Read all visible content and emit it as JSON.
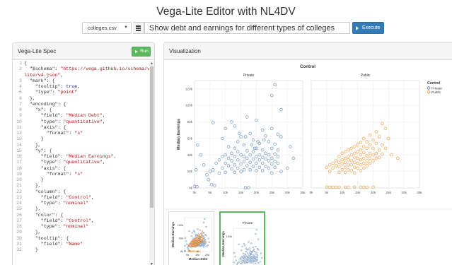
{
  "app": {
    "title": "Vega-Lite Editor with NL4DV"
  },
  "query": {
    "dataset": "colleges.csv",
    "text": "Show debt and earnings for different types of colleges",
    "execute_label": "Execute"
  },
  "spec_panel": {
    "title": "Vega-Lite Spec",
    "run_label": "Run",
    "lines": [
      {
        "n": "1",
        "t": "{"
      },
      {
        "n": "2",
        "t": "  \"$schema\": \"https://vega.github.io/schema/vega-"
      },
      {
        "n": "",
        "t": "lite/v4.json\","
      },
      {
        "n": "3",
        "t": "  \"mark\": {"
      },
      {
        "n": "4",
        "t": "    \"tooltip\": true,"
      },
      {
        "n": "5",
        "t": "    \"type\": \"point\""
      },
      {
        "n": "6",
        "t": "  },"
      },
      {
        "n": "7",
        "t": "  \"encoding\": {"
      },
      {
        "n": "8",
        "t": "    \"x\": {"
      },
      {
        "n": "9",
        "t": "      \"field\": \"Median Debt\","
      },
      {
        "n": "10",
        "t": "      \"type\": \"quantitative\","
      },
      {
        "n": "11",
        "t": "      \"axis\": {"
      },
      {
        "n": "12",
        "t": "        \"format\": \"s\""
      },
      {
        "n": "13",
        "t": "      }"
      },
      {
        "n": "14",
        "t": "    },"
      },
      {
        "n": "15",
        "t": "    \"y\": {"
      },
      {
        "n": "16",
        "t": "      \"field\": \"Median Earnings\","
      },
      {
        "n": "17",
        "t": "      \"type\": \"quantitative\","
      },
      {
        "n": "18",
        "t": "      \"axis\": {"
      },
      {
        "n": "19",
        "t": "        \"format\": \"s\""
      },
      {
        "n": "20",
        "t": "      }"
      },
      {
        "n": "21",
        "t": "    },"
      },
      {
        "n": "22",
        "t": "    \"column\": {"
      },
      {
        "n": "23",
        "t": "      \"field\": \"Control\","
      },
      {
        "n": "24",
        "t": "      \"type\": \"nominal\""
      },
      {
        "n": "25",
        "t": "    },"
      },
      {
        "n": "26",
        "t": "    \"color\": {"
      },
      {
        "n": "27",
        "t": "      \"field\": \"Control\","
      },
      {
        "n": "28",
        "t": "      \"type\": \"nominal\""
      },
      {
        "n": "29",
        "t": "    },"
      },
      {
        "n": "30",
        "t": "    \"tooltip\": {"
      },
      {
        "n": "31",
        "t": "      \"field\": \"Name\""
      },
      {
        "n": "32",
        "t": "    }"
      }
    ]
  },
  "viz_panel": {
    "title": "Visualization"
  },
  "chart_data": {
    "type": "scatter",
    "column_title": "Control",
    "facets": [
      "Private",
      "Public"
    ],
    "xlabel": "Median Debt",
    "ylabel": "Median Earnings",
    "x_ticks": [
      "0k",
      "5k",
      "10k",
      "15k",
      "20k",
      "25k",
      "30k",
      "35k"
    ],
    "y_ticks": [
      "0k",
      "20k",
      "40k",
      "60k",
      "80k",
      "100k",
      "120k"
    ],
    "xlim": [
      0,
      35000
    ],
    "ylim": [
      0,
      130000
    ],
    "legend": {
      "title": "Control",
      "entries": [
        "Private",
        "Public"
      ],
      "position": "top-right"
    },
    "colors": {
      "Private": "#4c78a8",
      "Public": "#f58518"
    },
    "series": [
      {
        "name": "Private",
        "points": [
          [
            26000,
            125000
          ],
          [
            25000,
            112000
          ],
          [
            28000,
            95000
          ],
          [
            17000,
            86000
          ],
          [
            20000,
            82000
          ],
          [
            12000,
            80000
          ],
          [
            6000,
            79000
          ],
          [
            10000,
            72000
          ],
          [
            13000,
            75000
          ],
          [
            22000,
            70000
          ],
          [
            25000,
            72000
          ],
          [
            27000,
            65000
          ],
          [
            18000,
            66000
          ],
          [
            15000,
            62000
          ],
          [
            9000,
            60000
          ],
          [
            23000,
            63000
          ],
          [
            28000,
            62000
          ],
          [
            31000,
            50000
          ],
          [
            14000,
            56000
          ],
          [
            19000,
            58000
          ],
          [
            21000,
            54000
          ],
          [
            24000,
            56000
          ],
          [
            26000,
            53000
          ],
          [
            16000,
            52000
          ],
          [
            11000,
            50000
          ],
          [
            13000,
            48000
          ],
          [
            20000,
            48000
          ],
          [
            22000,
            46000
          ],
          [
            25000,
            48000
          ],
          [
            27000,
            46000
          ],
          [
            17000,
            45000
          ],
          [
            19000,
            44000
          ],
          [
            14000,
            44000
          ],
          [
            12000,
            42000
          ],
          [
            23000,
            42000
          ],
          [
            21000,
            40000
          ],
          [
            24000,
            40000
          ],
          [
            26000,
            41000
          ],
          [
            18000,
            40000
          ],
          [
            15000,
            40000
          ],
          [
            16000,
            38000
          ],
          [
            20000,
            38000
          ],
          [
            22000,
            37000
          ],
          [
            25000,
            36000
          ],
          [
            27000,
            38000
          ],
          [
            13000,
            38000
          ],
          [
            11000,
            36000
          ],
          [
            10000,
            40000
          ],
          [
            9000,
            38000
          ],
          [
            17000,
            36000
          ],
          [
            19000,
            35000
          ],
          [
            21000,
            34000
          ],
          [
            23000,
            35000
          ],
          [
            24000,
            33000
          ],
          [
            26000,
            32000
          ],
          [
            14000,
            34000
          ],
          [
            12000,
            33000
          ],
          [
            16000,
            32000
          ],
          [
            18000,
            31000
          ],
          [
            20000,
            30000
          ],
          [
            22000,
            30000
          ],
          [
            25000,
            29000
          ],
          [
            27000,
            30000
          ],
          [
            15000,
            29000
          ],
          [
            13000,
            28000
          ],
          [
            10000,
            30000
          ],
          [
            8000,
            34000
          ],
          [
            7000,
            30000
          ],
          [
            11000,
            27000
          ],
          [
            17000,
            27000
          ],
          [
            19000,
            26000
          ],
          [
            21000,
            25000
          ],
          [
            23000,
            26000
          ],
          [
            24000,
            24000
          ],
          [
            26000,
            25000
          ],
          [
            14000,
            24000
          ],
          [
            12000,
            23000
          ],
          [
            9000,
            24000
          ],
          [
            6000,
            22000
          ],
          [
            16000,
            22000
          ],
          [
            18000,
            22000
          ],
          [
            20000,
            21000
          ],
          [
            22000,
            21000
          ],
          [
            15000,
            20000
          ],
          [
            13000,
            19000
          ],
          [
            10000,
            19000
          ],
          [
            8000,
            18000
          ],
          [
            5000,
            20000
          ],
          [
            4000,
            16000
          ],
          [
            25000,
            18000
          ],
          [
            28000,
            20000
          ],
          [
            30000,
            24000
          ],
          [
            32000,
            36000
          ],
          [
            3000,
            28000
          ],
          [
            2000,
            40000
          ],
          [
            1000,
            52000
          ],
          [
            500,
            22000
          ],
          [
            0,
            2000
          ],
          [
            800,
            1500
          ],
          [
            6500,
            3000
          ],
          [
            5500,
            4000
          ],
          [
            17500,
            500
          ],
          [
            16500,
            300
          ],
          [
            4500,
            10000
          ],
          [
            19500,
            48000
          ],
          [
            18500,
            52000
          ],
          [
            20500,
            56000
          ],
          [
            22500,
            58000
          ],
          [
            16500,
            62000
          ],
          [
            14500,
            66000
          ]
        ]
      },
      {
        "name": "Public",
        "points": [
          [
            24000,
            72000
          ],
          [
            23000,
            78000
          ],
          [
            21000,
            68000
          ],
          [
            19000,
            64000
          ],
          [
            17000,
            60000
          ],
          [
            22000,
            62000
          ],
          [
            20000,
            58000
          ],
          [
            25000,
            60000
          ],
          [
            18000,
            56000
          ],
          [
            16000,
            55000
          ],
          [
            15000,
            52000
          ],
          [
            14000,
            50000
          ],
          [
            19000,
            52000
          ],
          [
            21000,
            54000
          ],
          [
            23000,
            52000
          ],
          [
            17000,
            50000
          ],
          [
            13000,
            48000
          ],
          [
            12000,
            46000
          ],
          [
            16000,
            46000
          ],
          [
            18000,
            48000
          ],
          [
            20000,
            48000
          ],
          [
            22000,
            46000
          ],
          [
            24000,
            48000
          ],
          [
            15000,
            44000
          ],
          [
            11000,
            44000
          ],
          [
            10000,
            42000
          ],
          [
            14000,
            42000
          ],
          [
            17000,
            43000
          ],
          [
            19000,
            42000
          ],
          [
            21000,
            42000
          ],
          [
            23000,
            41000
          ],
          [
            13000,
            40000
          ],
          [
            16000,
            40000
          ],
          [
            18000,
            39000
          ],
          [
            20000,
            40000
          ],
          [
            12000,
            38000
          ],
          [
            9000,
            38000
          ],
          [
            11000,
            36000
          ],
          [
            14000,
            37000
          ],
          [
            15000,
            36000
          ],
          [
            17000,
            36000
          ],
          [
            19000,
            36000
          ],
          [
            21000,
            36000
          ],
          [
            22000,
            37000
          ],
          [
            10000,
            34000
          ],
          [
            12000,
            34000
          ],
          [
            13000,
            33000
          ],
          [
            16000,
            34000
          ],
          [
            18000,
            33000
          ],
          [
            20000,
            33000
          ],
          [
            8000,
            33000
          ],
          [
            9000,
            31000
          ],
          [
            11000,
            31000
          ],
          [
            14000,
            31000
          ],
          [
            15000,
            30000
          ],
          [
            17000,
            30000
          ],
          [
            19000,
            30000
          ],
          [
            7000,
            30000
          ],
          [
            10000,
            29000
          ],
          [
            12000,
            28000
          ],
          [
            13000,
            28000
          ],
          [
            16000,
            28000
          ],
          [
            18000,
            27000
          ],
          [
            6000,
            28000
          ],
          [
            8000,
            27000
          ],
          [
            9000,
            26000
          ],
          [
            11000,
            25000
          ],
          [
            14000,
            25000
          ],
          [
            15000,
            24000
          ],
          [
            17000,
            24000
          ],
          [
            5000,
            25000
          ],
          [
            7000,
            24000
          ],
          [
            10000,
            22000
          ],
          [
            12000,
            22000
          ],
          [
            13000,
            21000
          ],
          [
            16000,
            21000
          ],
          [
            6000,
            20000
          ],
          [
            9000,
            19000
          ],
          [
            11000,
            19000
          ],
          [
            14000,
            18000
          ],
          [
            5000,
            1000
          ],
          [
            6000,
            1000
          ],
          [
            7000,
            1000
          ],
          [
            8000,
            1000
          ],
          [
            9000,
            1000
          ],
          [
            11000,
            1000
          ],
          [
            12000,
            1000
          ],
          [
            14000,
            1000
          ],
          [
            16000,
            1000
          ],
          [
            17000,
            1000
          ],
          [
            18000,
            1000
          ],
          [
            20000,
            1000
          ],
          [
            28000,
            36000
          ],
          [
            26000,
            40000
          ]
        ]
      }
    ],
    "thumbnails": [
      {
        "selected": false,
        "xlabel": "Median Debt",
        "ylabel": "Median Earnings",
        "y_ticks": [
          "0k",
          "50k",
          "100k"
        ],
        "x_ticks": [
          "0k",
          "10k",
          "20k"
        ]
      },
      {
        "selected": true,
        "title": "Private",
        "ylabel": "Median Earnings",
        "y_ticks": [
          "0k",
          "100k"
        ]
      }
    ]
  }
}
